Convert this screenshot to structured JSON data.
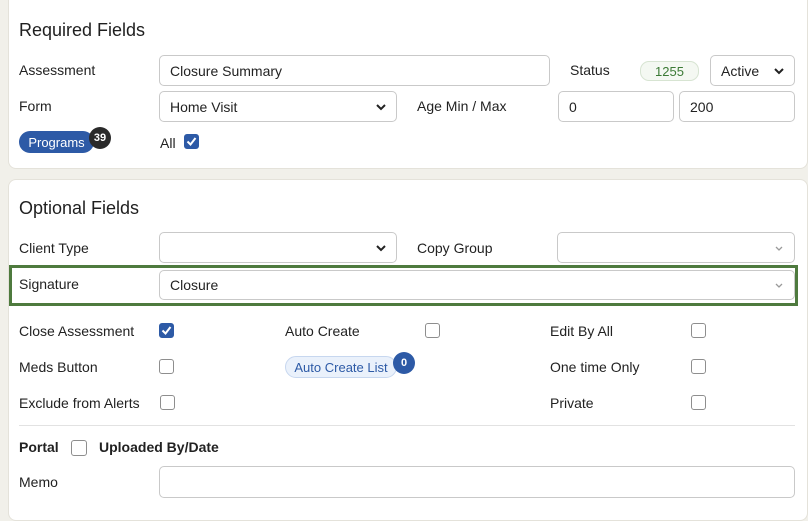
{
  "required": {
    "title": "Required Fields",
    "assessment_label": "Assessment",
    "assessment_value": "Closure Summary",
    "status_label": "Status",
    "status_id": "1255",
    "status_value": "Active",
    "form_label": "Form",
    "form_value": "Home Visit",
    "age_label": "Age Min / Max",
    "age_min": "0",
    "age_max": "200",
    "programs_label": "Programs",
    "programs_count": "39",
    "all_label": "All",
    "all_checked": true
  },
  "optional": {
    "title": "Optional Fields",
    "client_type_label": "Client Type",
    "client_type_value": "",
    "copy_group_label": "Copy Group",
    "copy_group_value": "",
    "signature_label": "Signature",
    "signature_value": "Closure",
    "checkboxes": [
      {
        "label": "Close Assessment",
        "checked": true
      },
      {
        "label": "Auto Create",
        "checked": false
      },
      {
        "label": "Edit By All",
        "checked": false
      },
      {
        "label": "Meds Button",
        "checked": false
      },
      {
        "label": "One time Only",
        "checked": false
      },
      {
        "label": "Exclude from Alerts",
        "checked": false
      },
      {
        "label": "Private",
        "checked": false
      }
    ],
    "auto_create_list_label": "Auto Create List",
    "auto_create_list_count": "0",
    "portal_label": "Portal",
    "portal_checked": false,
    "uploaded_label": "Uploaded By/Date",
    "memo_label": "Memo",
    "memo_value": ""
  },
  "colors": {
    "accent": "#2d5aa6",
    "highlight_border": "#4e7a3e",
    "status_green": "#3b7a35"
  },
  "icons": {
    "dropdown": "chevron-down-icon",
    "check": "check-icon"
  }
}
